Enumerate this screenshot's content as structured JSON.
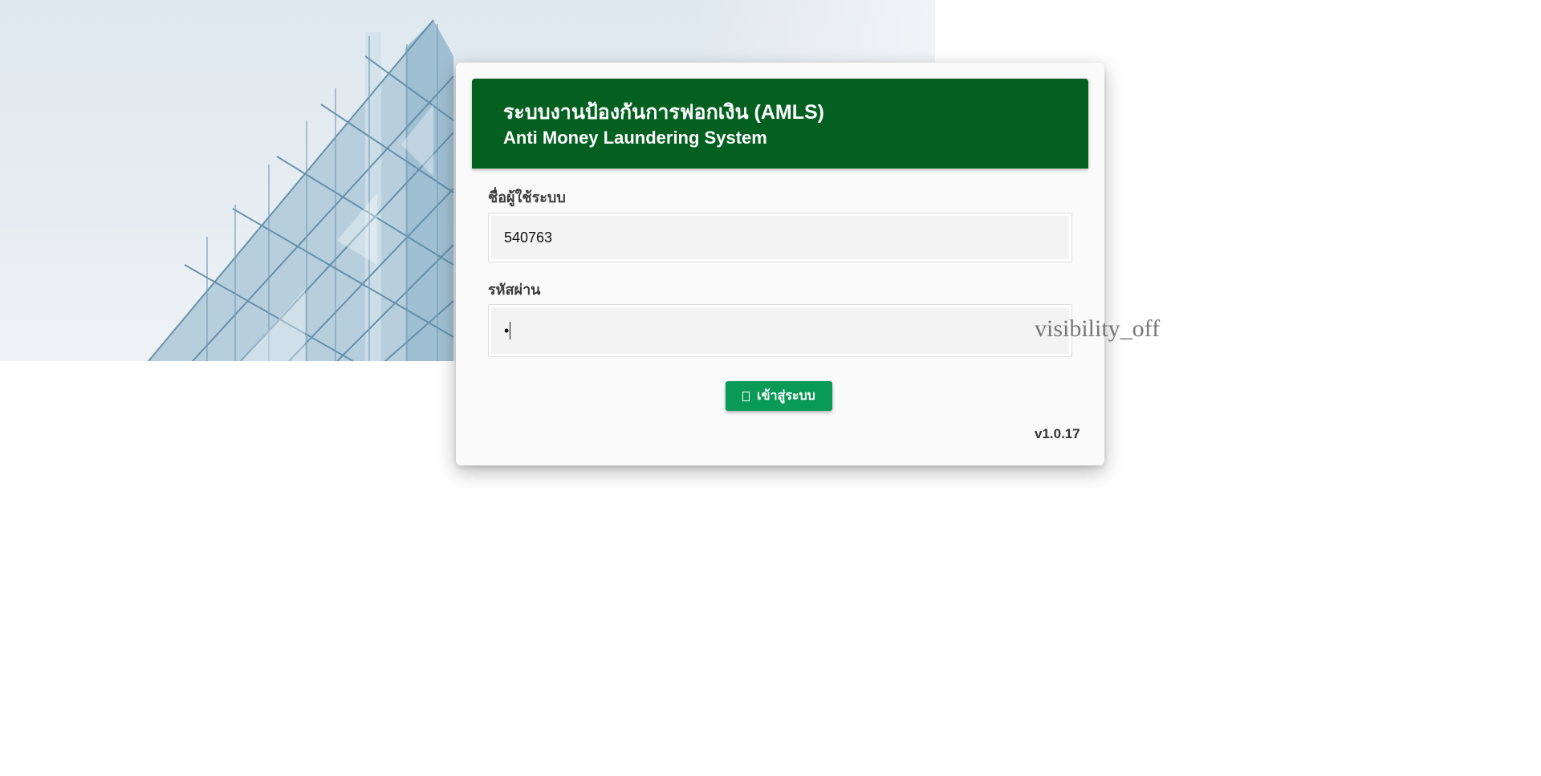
{
  "app": {
    "title_th": "ระบบงานป้องกันการฟอกเงิน (AMLS)",
    "title_en": "Anti Money Laundering System"
  },
  "form": {
    "username_label": "ชื่อผู้ใช้ระบบ",
    "username_value": "540763",
    "password_label": "รหัสผ่าน",
    "password_value": "•",
    "password_toggle_icon_text": "visibility_off",
    "login_button_label": "เข้าสู่ระบบ",
    "login_icon": "login-icon"
  },
  "footer": {
    "version": "v1.0.17"
  },
  "colors": {
    "header_green": "#046020",
    "button_green": "#0a9a57",
    "card_bg": "#fafafa"
  }
}
